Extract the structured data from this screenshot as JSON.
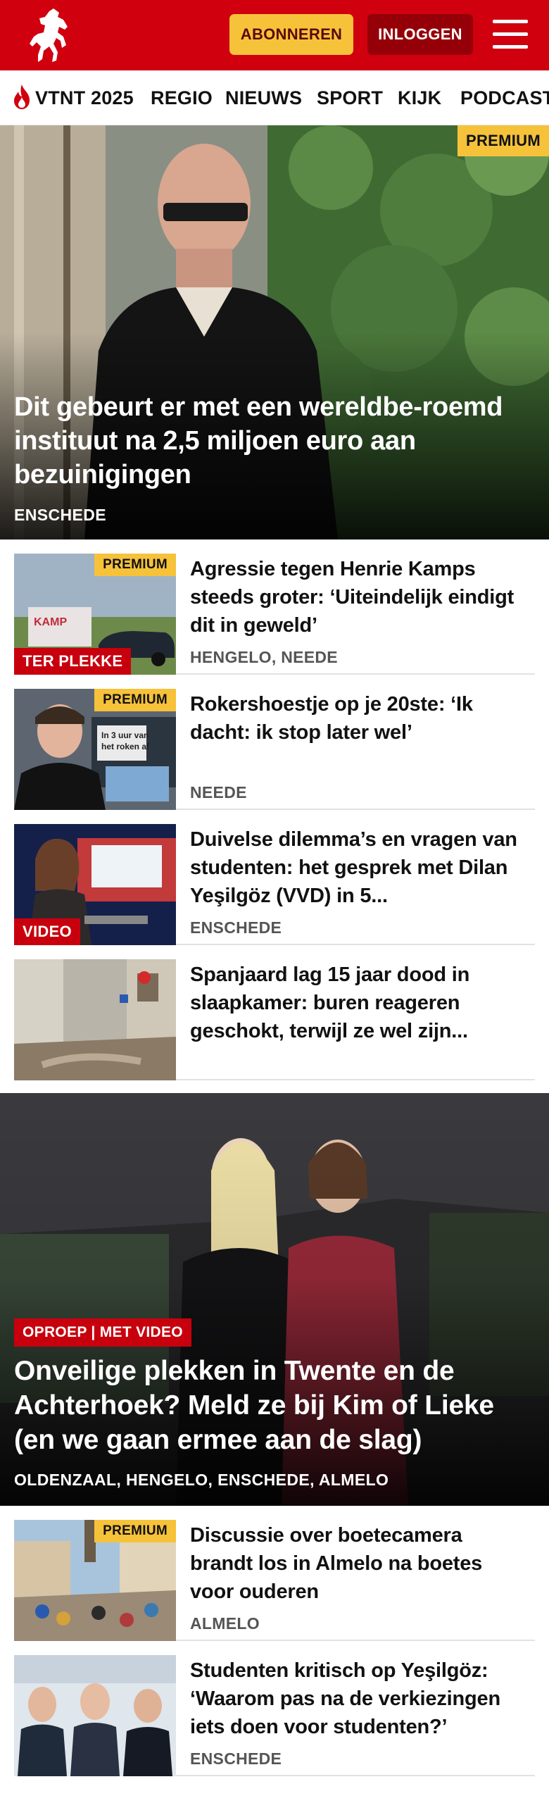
{
  "header": {
    "subscribe_label": "ABONNEREN",
    "login_label": "INLOGGEN",
    "brand_color": "#d0000f",
    "accent_color": "#f6c23a"
  },
  "nav": {
    "items": [
      "VTNT 2025",
      "REGIO",
      "NIEUWS",
      "SPORT",
      "KIJK",
      "PODCAST"
    ]
  },
  "hero": {
    "badge": "PREMIUM",
    "title": "Dit gebeurt er met een wereldbe-roemd instituut na 2,5 miljoen euro aan bezuinigingen",
    "location": "ENSCHEDE"
  },
  "articles": [
    {
      "badge": "PREMIUM",
      "tag": "TER PLEKKE",
      "title": "Agressie tegen Henrie Kamps steeds groter: ‘Uiteindelijk eindigt dit in geweld’",
      "location": "HENGELO, NEEDE"
    },
    {
      "badge": "PREMIUM",
      "tag": "",
      "title": "Rokershoestje op je 20ste: ‘Ik dacht: ik stop later wel’",
      "location": "NEEDE"
    },
    {
      "badge": "",
      "tag": "VIDEO",
      "title": "Duivelse dilemma’s en vragen van studenten: het gesprek met Dilan Yeşilgöz (VVD) in 5...",
      "location": "ENSCHEDE"
    },
    {
      "badge": "",
      "tag": "",
      "title": "Spanjaard lag 15 jaar dood in slaapkamer: buren reageren geschokt, terwijl ze wel zijn...",
      "location": ""
    }
  ],
  "feature": {
    "tag": "OPROEP | MET VIDEO",
    "title": "Onveilige plekken in Twente en de Achterhoek? Meld ze bij Kim of Lieke (en we gaan ermee aan de slag)",
    "location": "OLDENZAAL, HENGELO, ENSCHEDE, ALMELO"
  },
  "articles2": [
    {
      "badge": "PREMIUM",
      "title": "Discussie over boetecamera brandt los in Almelo na boetes voor ouderen",
      "location": "ALMELO"
    },
    {
      "badge": "",
      "title": "Studenten kritisch op Yeşilgöz: ‘Waarom pas na de verkiezingen iets doen voor studenten?’",
      "location": "ENSCHEDE"
    }
  ]
}
